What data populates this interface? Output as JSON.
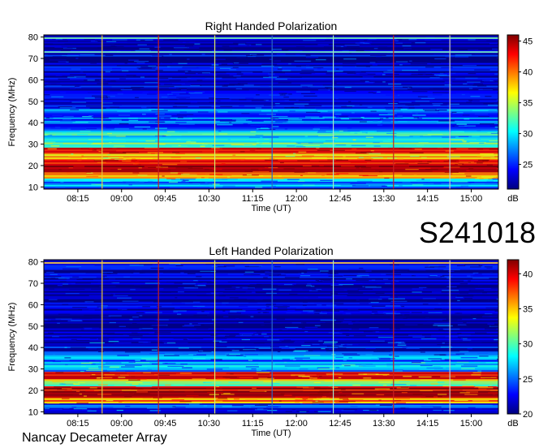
{
  "header": {
    "observation_id": "S241018"
  },
  "footer": {
    "instrument": "Nancay Decameter Array"
  },
  "chart_data": [
    {
      "type": "heatmap",
      "title": "Right Handed Polarization",
      "xlabel": "Time (UT)",
      "ylabel": "Frequency (MHz)",
      "x_ticks": [
        "08:15",
        "09:00",
        "09:45",
        "10:30",
        "11:15",
        "12:00",
        "12:45",
        "13:30",
        "14:15",
        "15:00"
      ],
      "x_tick_minutes": [
        495,
        540,
        585,
        630,
        675,
        720,
        765,
        810,
        855,
        900
      ],
      "xlim_minutes": [
        460,
        928
      ],
      "y_ticks": [
        10,
        20,
        30,
        40,
        50,
        60,
        70,
        80
      ],
      "ylim": [
        9,
        81
      ],
      "colorbar": {
        "label": "dB",
        "ticks": [
          25,
          30,
          35,
          40,
          45
        ],
        "range": [
          21,
          46
        ]
      },
      "bands": [
        {
          "f_low": 10,
          "f_high": 14,
          "level_db": 28
        },
        {
          "f_low": 14,
          "f_high": 17,
          "level_db": 40
        },
        {
          "f_low": 17,
          "f_high": 23,
          "level_db": 44
        },
        {
          "f_low": 23,
          "f_high": 26,
          "level_db": 37
        },
        {
          "f_low": 26,
          "f_high": 29,
          "level_db": 43
        },
        {
          "f_low": 29,
          "f_high": 33,
          "level_db": 32
        },
        {
          "f_low": 33,
          "f_high": 37,
          "level_db": 30
        },
        {
          "f_low": 37,
          "f_high": 47,
          "level_db": 26
        },
        {
          "f_low": 47,
          "f_high": 80,
          "level_db": 23
        }
      ],
      "horizontal_lines_mhz": [
        73,
        79.5
      ],
      "vertical_lines": [
        {
          "time_min": 520,
          "color": "#e8c840"
        },
        {
          "time_min": 578,
          "color": "#c82020"
        },
        {
          "time_min": 636,
          "color": "#d8e868"
        },
        {
          "time_min": 695,
          "color": "#2868c8"
        },
        {
          "time_min": 758,
          "color": "#a8e8c8"
        },
        {
          "time_min": 820,
          "color": "#c82020"
        },
        {
          "time_min": 878,
          "color": "#c8c8c8"
        }
      ]
    },
    {
      "type": "heatmap",
      "title": "Left Handed Polarization",
      "xlabel": "Time (UT)",
      "ylabel": "Frequency (MHz)",
      "x_ticks": [
        "08:15",
        "09:00",
        "09:45",
        "10:30",
        "11:15",
        "12:00",
        "12:45",
        "13:30",
        "14:15",
        "15:00"
      ],
      "x_tick_minutes": [
        495,
        540,
        585,
        630,
        675,
        720,
        765,
        810,
        855,
        900
      ],
      "xlim_minutes": [
        460,
        928
      ],
      "y_ticks": [
        10,
        20,
        30,
        40,
        50,
        60,
        70,
        80
      ],
      "ylim": [
        9,
        81
      ],
      "colorbar": {
        "label": "dB",
        "ticks": [
          20,
          25,
          30,
          35,
          40
        ],
        "range": [
          20,
          42
        ]
      },
      "bands": [
        {
          "f_low": 10,
          "f_high": 14,
          "level_db": 24
        },
        {
          "f_low": 14,
          "f_high": 17,
          "level_db": 37
        },
        {
          "f_low": 17,
          "f_high": 22,
          "level_db": 39
        },
        {
          "f_low": 22,
          "f_high": 25,
          "level_db": 31
        },
        {
          "f_low": 25,
          "f_high": 29,
          "level_db": 38
        },
        {
          "f_low": 29,
          "f_high": 34,
          "level_db": 27
        },
        {
          "f_low": 34,
          "f_high": 38,
          "level_db": 25
        },
        {
          "f_low": 38,
          "f_high": 45,
          "level_db": 23
        },
        {
          "f_low": 45,
          "f_high": 80,
          "level_db": 21
        }
      ],
      "horizontal_lines_mhz": [
        79.5
      ],
      "vertical_lines": [
        {
          "time_min": 520,
          "color": "#e8c840"
        },
        {
          "time_min": 578,
          "color": "#c82020"
        },
        {
          "time_min": 636,
          "color": "#d8e868"
        },
        {
          "time_min": 695,
          "color": "#2868c8"
        },
        {
          "time_min": 758,
          "color": "#a8e8c8"
        },
        {
          "time_min": 820,
          "color": "#c82020"
        },
        {
          "time_min": 878,
          "color": "#c8c8c8"
        }
      ]
    }
  ]
}
